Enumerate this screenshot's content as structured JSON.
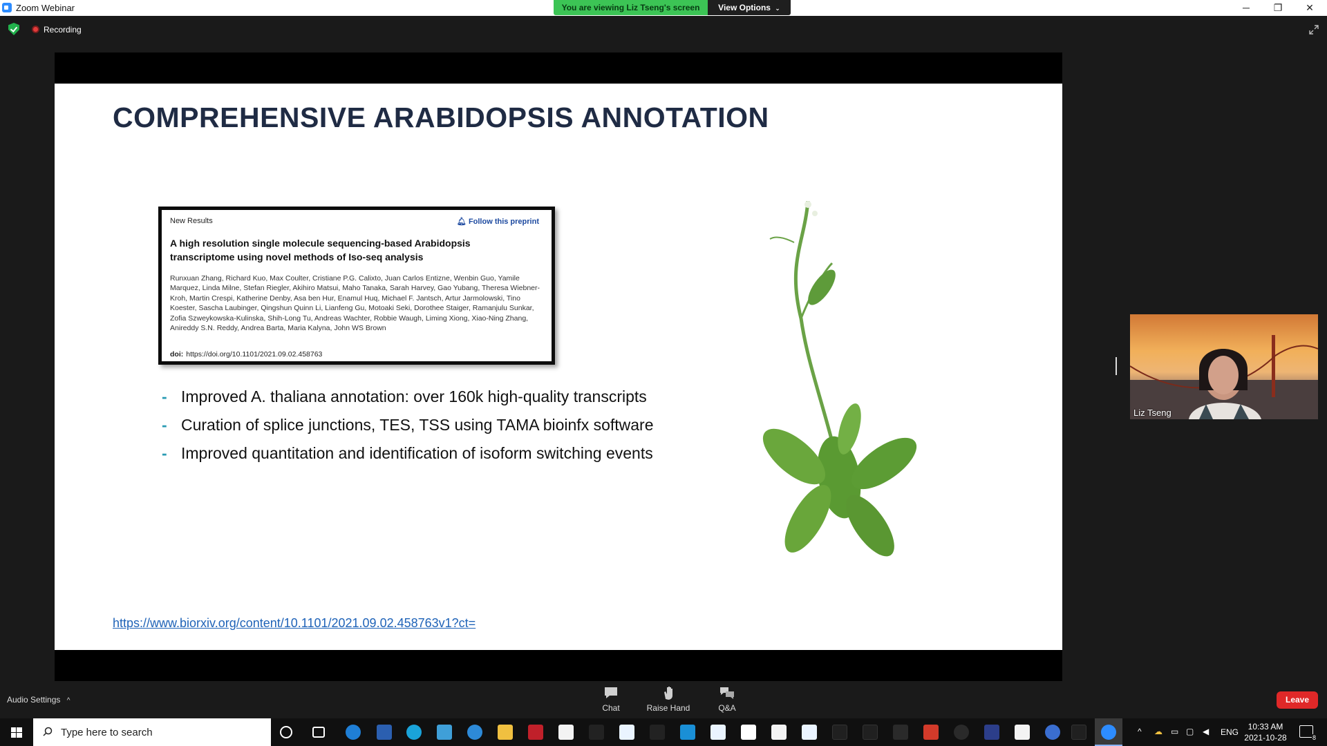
{
  "window": {
    "title": "Zoom Webinar",
    "viewing_banner": "You are viewing Liz Tseng's screen",
    "view_options": "View Options",
    "controls": [
      "─",
      "❐",
      "✕"
    ]
  },
  "meeting_bar": {
    "recording_label": "Recording"
  },
  "slide": {
    "title": "COMPREHENSIVE ARABIDOPSIS ANNOTATION",
    "paper": {
      "tag": "New Results",
      "follow": "Follow this preprint",
      "title": "A high resolution single molecule sequencing-based Arabidopsis transcriptome using novel methods of Iso-seq analysis",
      "authors": "Runxuan Zhang, Richard Kuo, Max Coulter, Cristiane P.G. Calixto, Juan Carlos Entizne, Wenbin Guo, Yamile Marquez, Linda Milne, Stefan Riegler, Akihiro Matsui, Maho Tanaka, Sarah Harvey, Gao Yubang, Theresa Wiebner-Kroh, Martin Crespi, Katherine Denby, Asa ben Hur, Enamul Huq, Michael F. Jantsch, Artur Jarmolowski, Tino Koester, Sascha Laubinger, Qingshun Quinn Li, Lianfeng Gu, Motoaki Seki, Dorothee Staiger, Ramanjulu Sunkar, Zofia Szweykowska-Kulinska, Shih-Long Tu, Andreas Wachter, Robbie Waugh, Liming Xiong, Xiao-Ning Zhang, Anireddy S.N. Reddy, Andrea Barta, Maria Kalyna, John WS Brown",
      "doi_label": "doi:",
      "doi": "https://doi.org/10.1101/2021.09.02.458763"
    },
    "bullets": [
      "Improved A. thaliana annotation: over 160k high-quality transcripts",
      "Curation of splice junctions, TES, TSS using TAMA bioinfx software",
      "Improved quantitation and identification of isoform switching events"
    ],
    "link": "https://www.biorxiv.org/content/10.1101/2021.09.02.458763v1?ct="
  },
  "webcam": {
    "name": "Liz Tseng"
  },
  "control_bar": {
    "audio_settings": "Audio Settings",
    "buttons": [
      {
        "label": "Chat",
        "icon": "chat-icon"
      },
      {
        "label": "Raise Hand",
        "icon": "hand-icon"
      },
      {
        "label": "Q&A",
        "icon": "qa-icon"
      }
    ],
    "leave": "Leave"
  },
  "taskbar": {
    "search_placeholder": "Type here to search",
    "language": "ENG",
    "time": "10:33 AM",
    "date": "2021-10-28",
    "notification_count": "8"
  },
  "colors": {
    "slide_title": "#1f2b44",
    "bullet_dash": "#2a9bb3",
    "link": "#1f63b8",
    "leave": "#e02828",
    "viewing_banner": "#3cc455"
  }
}
